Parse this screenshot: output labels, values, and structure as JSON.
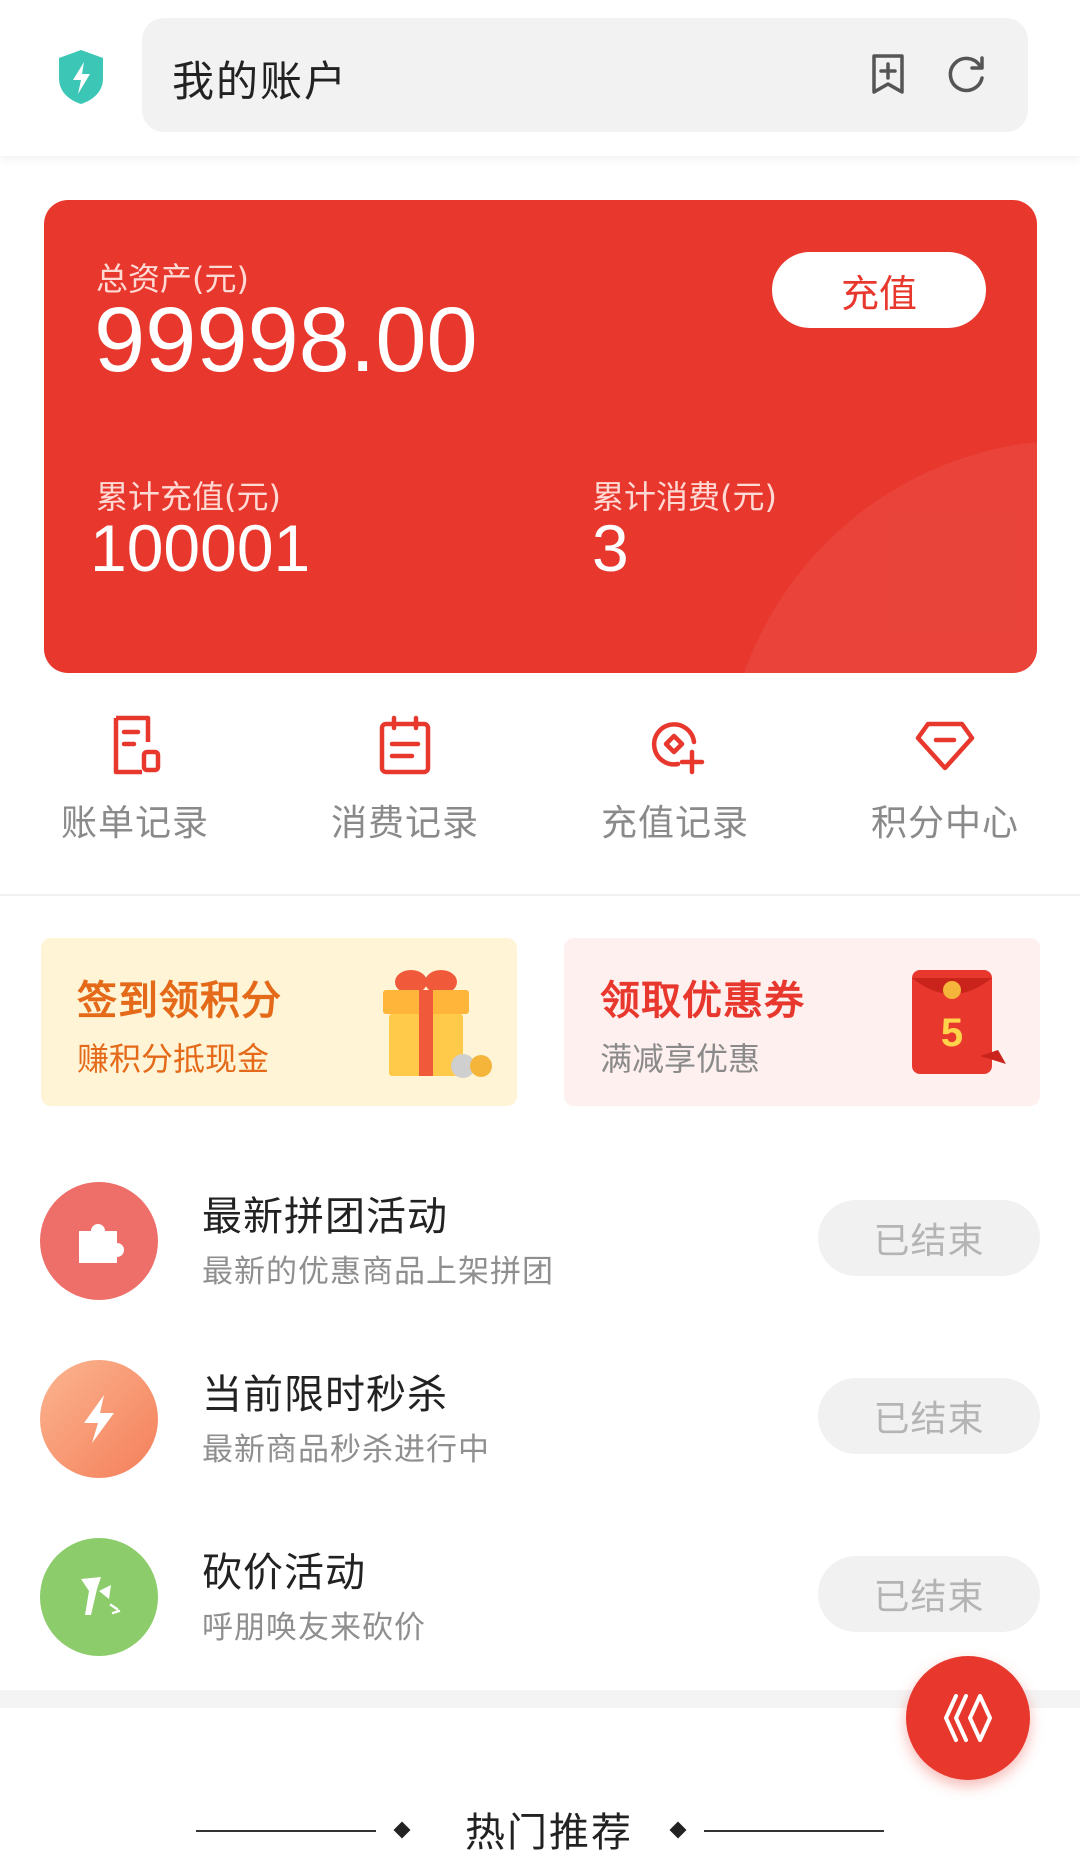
{
  "header": {
    "title": "我的账户",
    "icons": [
      "shield-bolt-icon",
      "bookmark-add-icon",
      "refresh-icon"
    ]
  },
  "assets": {
    "total_label": "总资产(元)",
    "total_value": "99998.00",
    "recharge_button": "充值",
    "cum_recharge_label": "累计充值(元)",
    "cum_recharge_value": "100001",
    "cum_spend_label": "累计消费(元)",
    "cum_spend_value": "3"
  },
  "quick_nav": [
    {
      "label": "账单记录",
      "icon": "bill-icon"
    },
    {
      "label": "消费记录",
      "icon": "calendar-icon"
    },
    {
      "label": "充值记录",
      "icon": "recharge-icon"
    },
    {
      "label": "积分中心",
      "icon": "diamond-icon"
    }
  ],
  "promos": {
    "signin": {
      "title": "签到领积分",
      "subtitle": "赚积分抵现金"
    },
    "coupon": {
      "title": "领取优惠券",
      "subtitle": "满减享优惠",
      "badge": "5"
    }
  },
  "activities": [
    {
      "title": "最新拼团活动",
      "subtitle": "最新的优惠商品上架拼团",
      "status": "已结束",
      "icon": "puzzle-icon"
    },
    {
      "title": "当前限时秒杀",
      "subtitle": "最新商品秒杀进行中",
      "status": "已结束",
      "icon": "lightning-icon"
    },
    {
      "title": "砍价活动",
      "subtitle": "呼朋唤友来砍价",
      "status": "已结束",
      "icon": "axe-icon"
    }
  ],
  "hot": {
    "title": "热门推荐"
  },
  "colors": {
    "primary": "#e8382e",
    "signin_bg": "#fff4d5",
    "coupon_bg": "#fff0f0"
  }
}
